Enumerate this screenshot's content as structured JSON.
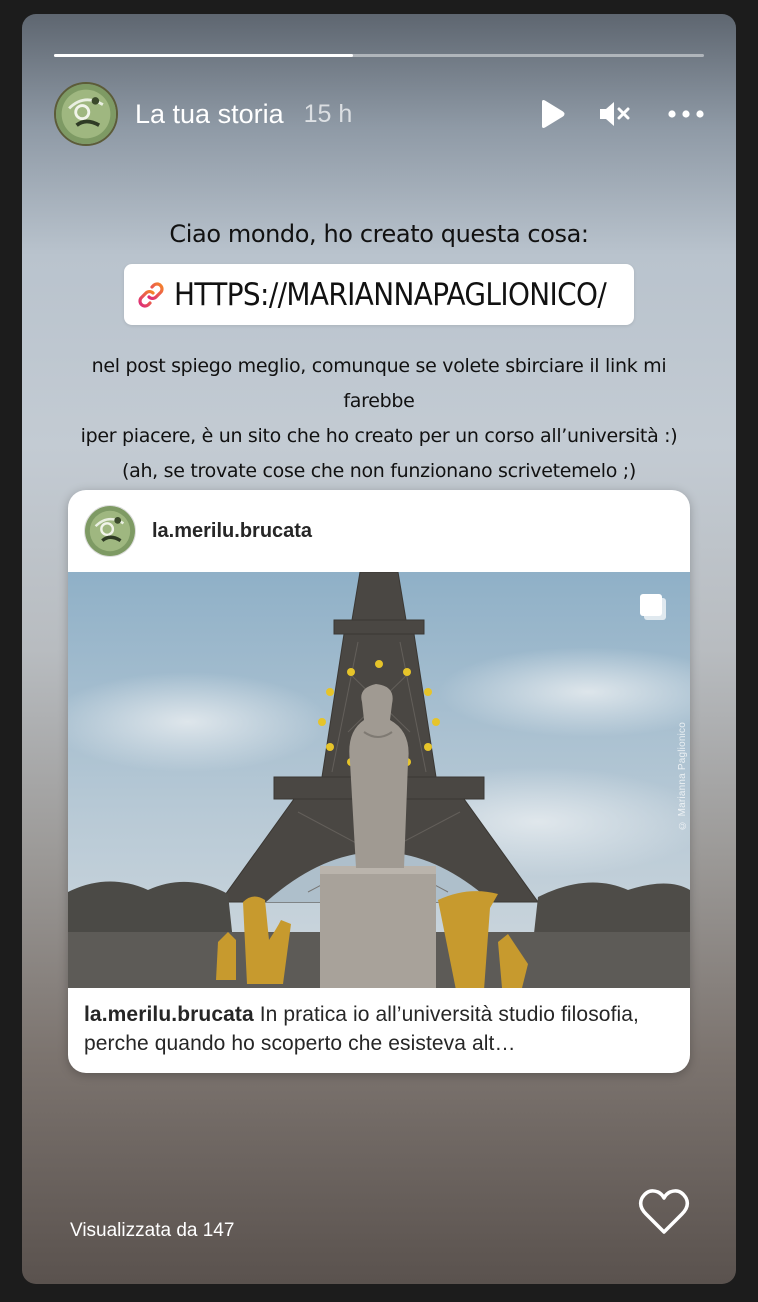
{
  "story": {
    "progress_fraction": 0.46,
    "user_name": "La tua storia",
    "time_ago": "15 h",
    "icons": {
      "play": "play-icon",
      "mute": "speaker-muted-icon",
      "more": "more-dots-icon",
      "link": "link-icon",
      "multi": "multiple-photos-icon",
      "like": "heart-icon"
    }
  },
  "sticker": {
    "caption_top": "Ciao mondo, ho creato questa cosa:",
    "link_text": "HTTPS://MARIANNAPAGLIONICO/",
    "caption_lines": [
      "nel post spiego meglio, comunque se volete sbirciare il link mi farebbe",
      "iper piacere, è un sito che ho creato per un corso all’università :)",
      "(ah, se trovate cose che non funzionano scrivetemelo ;)"
    ]
  },
  "post": {
    "username": "la.merilu.brucata",
    "watermark": "© Marianna Paglionico",
    "caption_user": "la.merilu.brucata",
    "caption_text": "In pratica io all’università studio filosofia, perche quando ho scoperto che esisteva alt…"
  },
  "footer": {
    "views": "Visualizzata da 147"
  },
  "colors": {
    "link_gradient_start": "#f58529",
    "link_gradient_end": "#dd2a7b",
    "accent_white": "#ffffff"
  }
}
